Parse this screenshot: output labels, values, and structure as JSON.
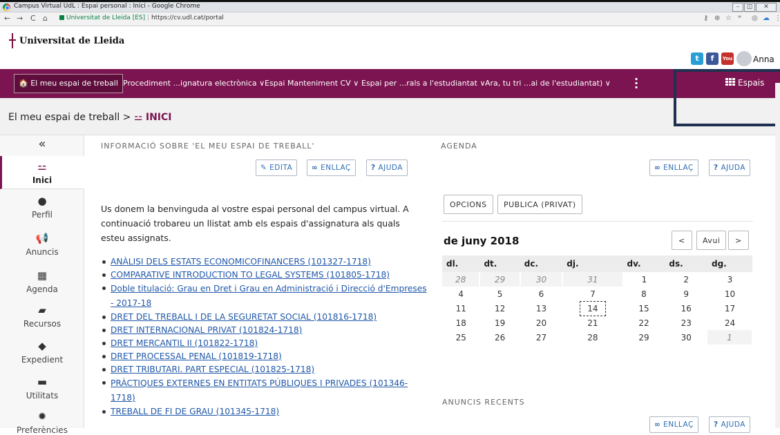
{
  "browser": {
    "title": "Campus Virtual UdL : Espai personal : Inici - Google Chrome",
    "site_name": "Universitat de Lleida [ES]",
    "url": "https://cv.udl.cat/portal"
  },
  "header": {
    "logo_text": "Universitat de Lleida",
    "user": "Anna",
    "social": [
      "twitter",
      "facebook",
      "youtube"
    ]
  },
  "nav": {
    "home": "El meu espai de treball",
    "items": [
      "Procediment ...ignatura electrònica ∨",
      "Espai Manteniment CV ∨",
      "Espai per ...rals a l'estudiantat ∨",
      "Ara, tu tri ...ai de l'estudiantat) ∨"
    ],
    "more": "⋮",
    "espais": "Espais"
  },
  "breadcrumb": {
    "root": "El meu espai de treball",
    "separator": ">",
    "current": "INICI"
  },
  "sidebar": {
    "collapse": "«",
    "items": [
      {
        "label": "Inici",
        "icon": "signpost-icon"
      },
      {
        "label": "Perfil",
        "icon": "user-icon"
      },
      {
        "label": "Anuncis",
        "icon": "megaphone-icon"
      },
      {
        "label": "Agenda",
        "icon": "calendar-icon"
      },
      {
        "label": "Recursos",
        "icon": "folder-icon"
      },
      {
        "label": "Expedient",
        "icon": "graduation-cap-icon"
      },
      {
        "label": "Utilitats",
        "icon": "briefcase-icon"
      },
      {
        "label": "Preferències",
        "icon": "gear-icon"
      }
    ]
  },
  "info": {
    "title": "INFORMACIÓ SOBRE 'EL MEU ESPAI DE TREBALL'",
    "edit": "EDITA",
    "link": "ENLLAÇ",
    "help": "AJUDA",
    "intro": "Us donem la benvinguda al vostre espai personal del campus virtual. A continuació trobareu un llistat amb els espais d'assignatura als quals esteu assignats.",
    "courses": [
      "ANÀLISI DELS ESTATS ECONOMICOFINANCERS (101327-1718)",
      "COMPARATIVE INTRODUCTION TO LEGAL SYSTEMS (101805-1718)",
      "Doble titulació: Grau en Dret i Grau en Administració i Direcció d'Empreses - 2017-18",
      "DRET DEL TREBALL I DE LA SEGURETAT SOCIAL (101816-1718)",
      "DRET INTERNACIONAL PRIVAT (101824-1718)",
      "DRET MERCANTIL II (101822-1718)",
      "DRET PROCESSAL PENAL (101819-1718)",
      "DRET TRIBUTARI. PART ESPECIAL (101825-1718)",
      "PRÀCTIQUES EXTERNES EN ENTITATS PÚBLIQUES I PRIVADES (101346-1718)",
      "TREBALL DE FI DE GRAU (101345-1718)"
    ]
  },
  "agenda": {
    "title": "AGENDA",
    "link": "ENLLAÇ",
    "help": "AJUDA",
    "options": "OPCIONS",
    "publish": "PUBLICA (PRIVAT)",
    "month": "de juny 2018",
    "prev": "<",
    "today": "Avui",
    "next": ">",
    "days": [
      "dl.",
      "dt.",
      "dc.",
      "dj.",
      "dv.",
      "ds.",
      "dg."
    ],
    "weeks": [
      [
        "28",
        "29",
        "30",
        "31",
        "1",
        "2",
        "3"
      ],
      [
        "4",
        "5",
        "6",
        "7",
        "8",
        "9",
        "10"
      ],
      [
        "11",
        "12",
        "13",
        "14",
        "15",
        "16",
        "17"
      ],
      [
        "18",
        "19",
        "20",
        "21",
        "22",
        "23",
        "24"
      ],
      [
        "25",
        "26",
        "27",
        "28",
        "29",
        "30",
        "1"
      ]
    ],
    "today_date": "14"
  },
  "news": {
    "title": "ANUNCIS RECENTS",
    "link": "ENLLAÇ",
    "help": "AJUDA"
  }
}
